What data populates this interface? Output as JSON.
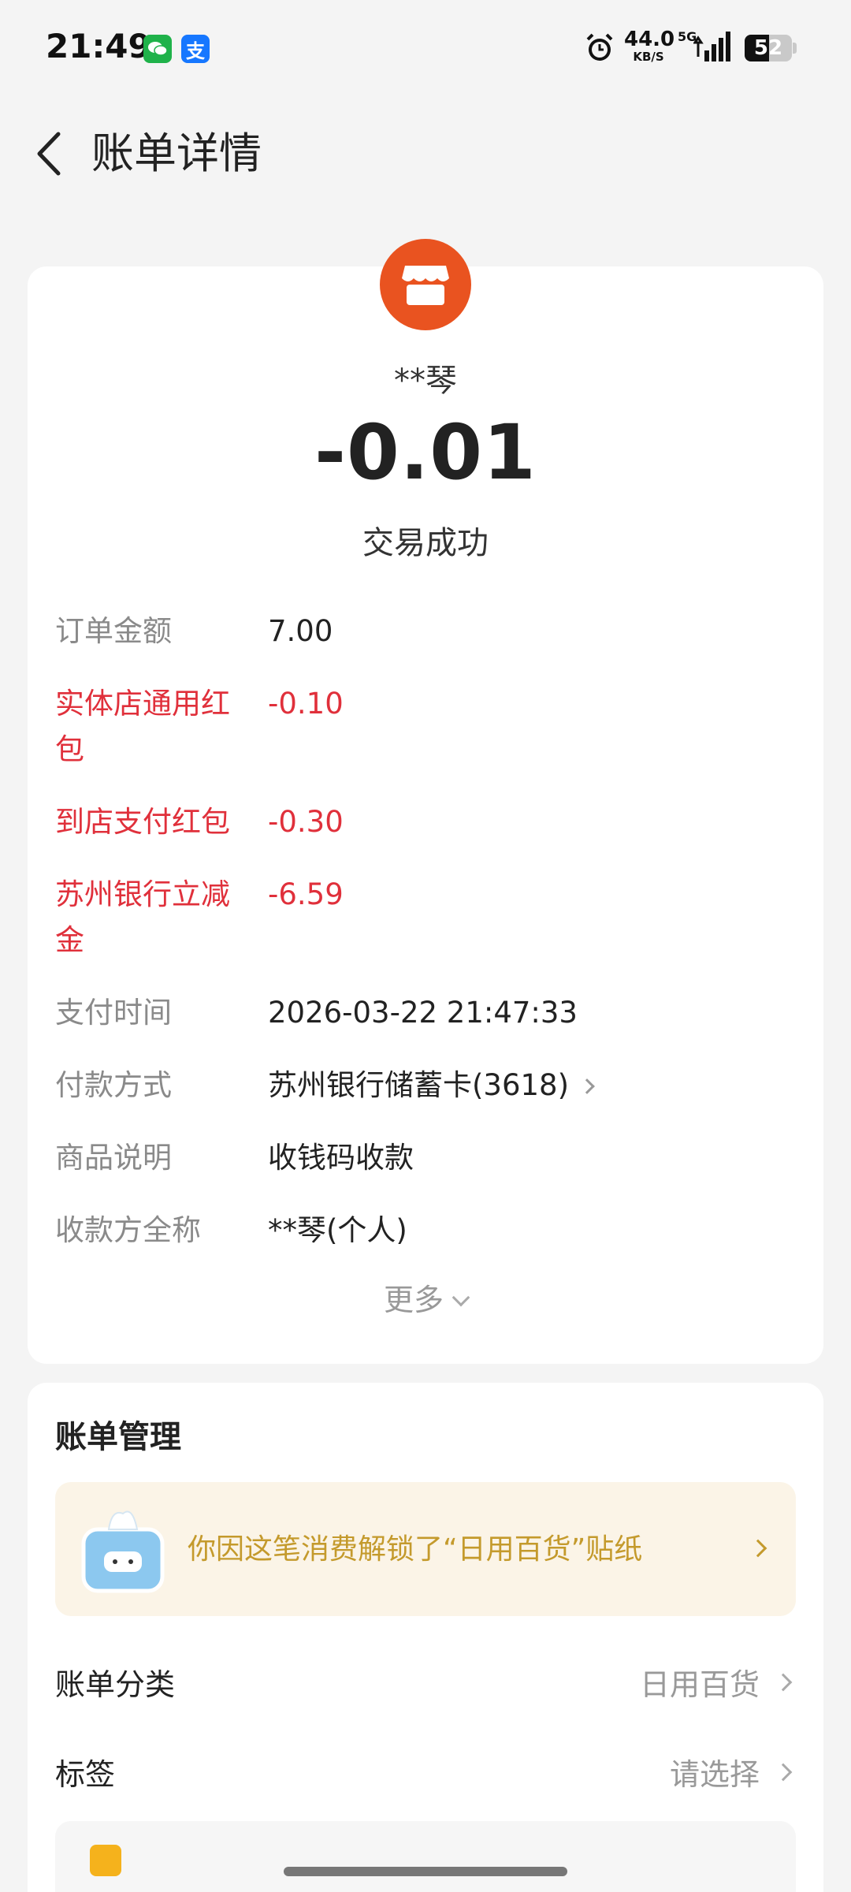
{
  "status_bar": {
    "time": "21:49",
    "net_speed": "44.0",
    "net_unit": "KB/S",
    "network": "5G",
    "battery": "52",
    "battery_level": 0.52,
    "icons": [
      "wechat-icon",
      "alipay-icon",
      "alarm-icon",
      "signal-icon",
      "battery-icon"
    ]
  },
  "header": {
    "title": "账单详情"
  },
  "transaction": {
    "merchant": "**琴",
    "amount": "-0.01",
    "status": "交易成功",
    "logo_color": "#e95320",
    "rows": [
      {
        "label": "订单金额",
        "value": "7.00"
      },
      {
        "label": "实体店通用红包",
        "value": "-0.10"
      },
      {
        "label": "到店支付红包",
        "value": "-0.30"
      },
      {
        "label": "苏州银行立减金",
        "value": "-6.59"
      },
      {
        "label": "支付时间",
        "value": "2026-03-22 21:47:33"
      },
      {
        "label": "付款方式",
        "value": "苏州银行储蓄卡(3618)"
      },
      {
        "label": "商品说明",
        "value": "收钱码收款"
      },
      {
        "label": "收款方全称",
        "value": "**琴(个人)"
      }
    ],
    "more_label": "更多"
  },
  "manage": {
    "title": "账单管理",
    "sticker_text": "你因这笔消费解锁了“日用百货”贴纸",
    "category_label": "账单分类",
    "category_value": "日用百货",
    "tag_label": "标签",
    "tag_value": "请选择"
  },
  "colors": {
    "accent_red": "#e0303b",
    "sticker_gold": "#c49a2c",
    "background": "#f4f4f4"
  }
}
